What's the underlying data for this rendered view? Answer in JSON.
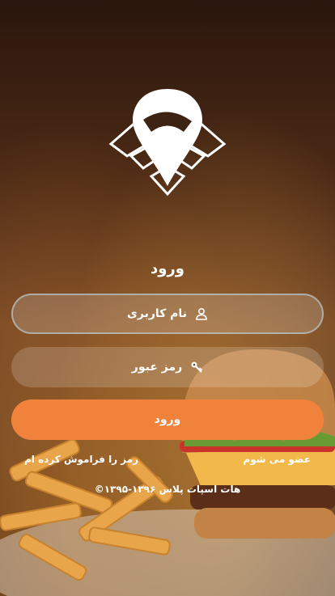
{
  "login": {
    "title": "ورود",
    "username_label": "نام کاربری",
    "password_label": "رمز عبور",
    "submit_label": "ورود",
    "join_label": "عضو می شوم",
    "forgot_label": "رمز را فراموش کرده ام",
    "copyright": "©۱۳۹۵-۱۳۹۶ هات اسپات پلاس"
  },
  "icons": {
    "logo": "location-pin-wifi-logo",
    "username": "user-icon",
    "password": "key-icon"
  },
  "colors": {
    "accent": "#f0823c",
    "text": "#ffffff"
  }
}
